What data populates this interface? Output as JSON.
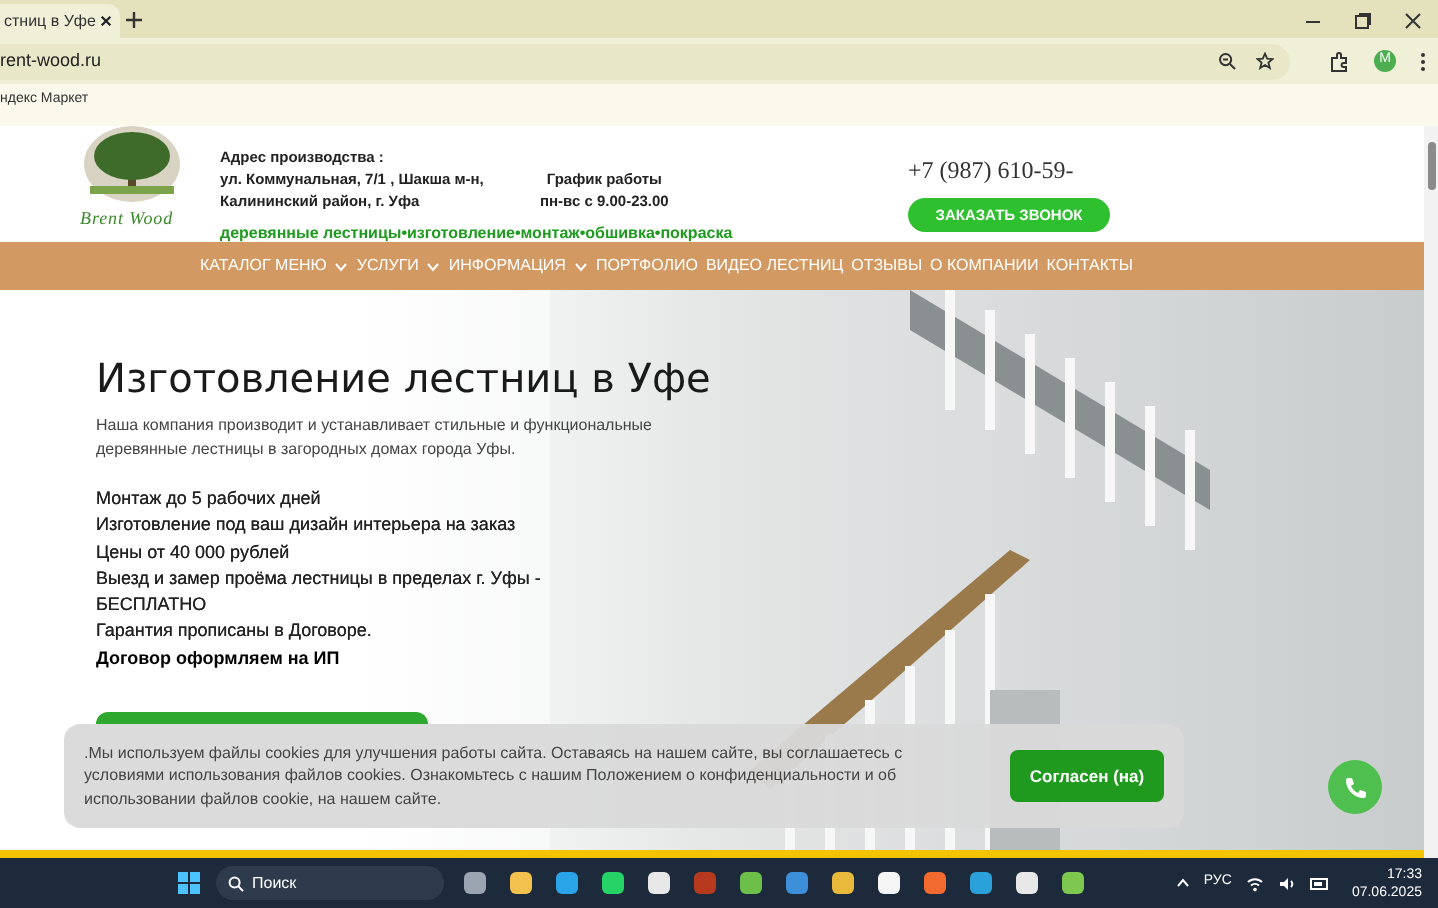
{
  "browser": {
    "tab_title": "стниц в Уфе",
    "url": "rent-wood.ru",
    "bookmarks": [
      "ндекс Маркет"
    ],
    "profile_initial": "М"
  },
  "header": {
    "logo_text": "Brent Wood",
    "address": [
      "Адрес производства :",
      "ул. Коммунальная, 7/1 , Шакша м-н,",
      "Калининский район, г. Уфа"
    ],
    "schedule": [
      "График работы",
      "пн-вс с 9.00-23.00"
    ],
    "phone": "+7 (987) 610-59-",
    "callback_button": "ЗАКАЗАТЬ ЗВОНОК",
    "tagline": "деревянные лестницы•изготовление•монтаж•обшивка•покраска"
  },
  "nav": [
    {
      "label": "КАТАЛОГ МЕНЮ",
      "has_dropdown": true
    },
    {
      "label": "УСЛУГИ",
      "has_dropdown": true
    },
    {
      "label": "ИНФОРМАЦИЯ",
      "has_dropdown": true
    },
    {
      "label": "ПОРТФОЛИО",
      "has_dropdown": false
    },
    {
      "label": "ВИДЕО ЛЕСТНИЦ",
      "has_dropdown": false
    },
    {
      "label": "ОТЗЫВЫ",
      "has_dropdown": false
    },
    {
      "label": "О КОМПАНИИ",
      "has_dropdown": false
    },
    {
      "label": "КОНТАКТЫ",
      "has_dropdown": false
    }
  ],
  "hero": {
    "title": "Изготовление лестниц в Уфе",
    "intro": "Наша компания производит и устанавливает стильные и функциональные деревянные лестницы в загородных домах города Уфы.",
    "features": [
      {
        "text": "Монтаж до 5 рабочих дней",
        "emphasis": false
      },
      {
        "text": "Изготовление под ваш дизайн интерьера на заказ",
        "emphasis": false
      },
      {
        "text": "Цены от 40 000 рублей",
        "emphasis": false
      },
      {
        "text": "Выезд и замер проёма лестницы в пределах г. Уфы - БЕСПЛАТНО",
        "emphasis": false
      },
      {
        "text": "Гарантия прописаны в Договоре.",
        "emphasis": false
      },
      {
        "text": "Договор оформляем на ИП",
        "emphasis": true
      }
    ]
  },
  "cookie_banner": {
    "text": ".Мы используем файлы cookies для улучшения работы сайта. Оставаясь на нашем сайте, вы соглашаетесь с условиями использования файлов cookies. Ознакомьтесь с нашим Положением о конфиденциальности и об использовании файлов cookie, на нашем сайте.",
    "button": "Согласен (на)"
  },
  "taskbar": {
    "search_placeholder": "Поиск",
    "language": "РУС",
    "time": "17:33",
    "date": "07.06.2025"
  }
}
